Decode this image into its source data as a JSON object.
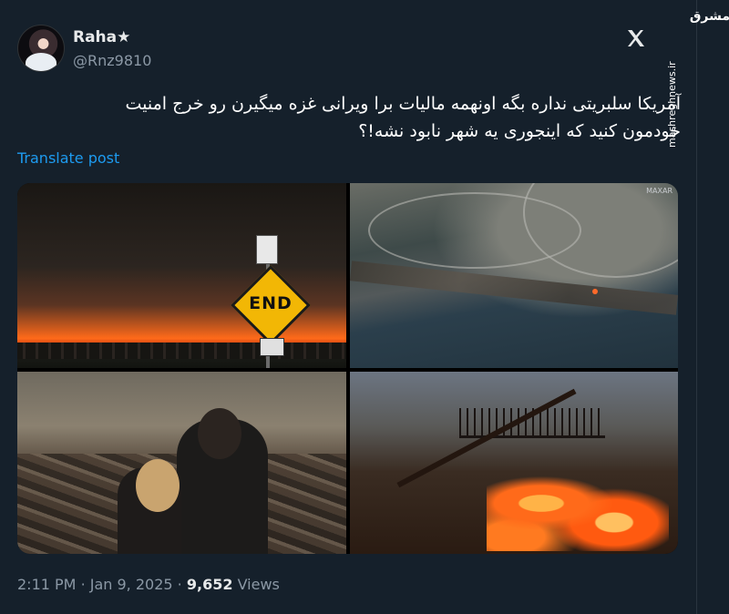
{
  "author": {
    "display_name": "Raha★",
    "handle": "@Rnz9810"
  },
  "post": {
    "text_line1": "آمریکا سلبریتی نداره بگه اونهمه مالیات برا ویرانی غزه میگیرن رو خرج امنیت",
    "text_line2": "خودمون کنید که اینجوری یه شهر نابود نشه!؟",
    "translate_label": "Translate post"
  },
  "media": {
    "sign_text": "END",
    "satellite_credit": "MAXAR"
  },
  "footer": {
    "time": "2:11 PM",
    "separator": "·",
    "date": "Jan 9, 2025",
    "views_count": "9,652",
    "views_label": "Views"
  },
  "watermark": {
    "logo_text": "مشرق",
    "site": "mashreghnews.ir"
  },
  "colors": {
    "background": "#15202b",
    "link": "#1d9bf0",
    "muted": "#8b98a5"
  },
  "icons": [
    "x-logo-icon"
  ]
}
